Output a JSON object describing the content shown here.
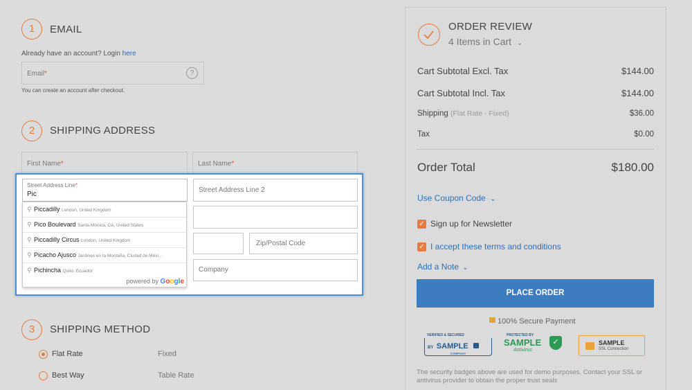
{
  "email_section": {
    "step": "1",
    "title": "EMAIL",
    "account_prompt": "Already have an account? Login",
    "login_link": "here",
    "email_label": "Email",
    "required_mark": "*",
    "help_icon": "?",
    "hint": "You can create an account after checkout."
  },
  "shipping_address": {
    "step": "2",
    "title": "SHIPPING ADDRESS",
    "first_name_label": "First Name",
    "last_name_label": "Last Name",
    "required_mark": "*",
    "street1_label": "Street Address Line",
    "street1_value": "Pic",
    "street2_placeholder": "Street Address Line 2",
    "zip_placeholder": "Zip/Postal Code",
    "company_placeholder": "Company"
  },
  "autocomplete": {
    "items": [
      {
        "main": "Piccadilly",
        "sub": "London, United Kingdom"
      },
      {
        "main": "Pico Boulevard",
        "sub": "Santa Monica, CA, United States"
      },
      {
        "main": "Piccadilly Circus",
        "sub": "London, United Kingdom"
      },
      {
        "main": "Picacho Ajusco",
        "sub": "Jardines en la Montaña, Ciudad de Méxi..."
      },
      {
        "main": "Pichincha",
        "sub": "Quito, Ecuador"
      }
    ],
    "powered_by": "powered by",
    "google_letters": [
      "G",
      "o",
      "o",
      "g",
      "l",
      "e"
    ]
  },
  "shipping_method": {
    "step": "3",
    "title": "SHIPPING METHOD",
    "options": [
      {
        "label": "Flat Rate",
        "carrier": "Fixed",
        "selected": true
      },
      {
        "label": "Best Way",
        "carrier": "Table Rate",
        "selected": false
      }
    ]
  },
  "order_review": {
    "title": "ORDER REVIEW",
    "items_count": "4 Items in Cart",
    "rows": {
      "subtotal_excl_label": "Cart Subtotal Excl. Tax",
      "subtotal_excl_value": "$144.00",
      "subtotal_incl_label": "Cart Subtotal Incl. Tax",
      "subtotal_incl_value": "$144.00",
      "shipping_label": "Shipping",
      "shipping_note": "(Flat Rate - Fixed)",
      "shipping_value": "$36.00",
      "tax_label": "Tax",
      "tax_value": "$0.00"
    },
    "total_label": "Order Total",
    "total_value": "$180.00",
    "coupon_link": "Use Coupon Code",
    "newsletter_label": "Sign up for Newsletter",
    "terms_label": "I accept these terms and conditions",
    "add_note": "Add a Note",
    "place_order": "PLACE ORDER",
    "secure_payment": "100% Secure Payment",
    "badges": {
      "b1_top": "VERIFIED & SECURED",
      "b1_by": "BY",
      "b1_main": "SAMPLE",
      "b1_sub": "COMPANY",
      "b2_top": "PROTECTED BY",
      "b2_main": "SAMPLE",
      "b2_sub": "Antivirus",
      "b3_main": "SAMPLE",
      "b3_sub": "SSL Connection"
    },
    "disclaimer": "The security badges above are used for demo purposes. Contact your SSL or antivirus provider to obtain the proper trust seals"
  },
  "colors": {
    "accent": "#e87c40",
    "link": "#2a70b8",
    "button": "#3d7cbf",
    "overlay_border": "#4a8fd6"
  }
}
